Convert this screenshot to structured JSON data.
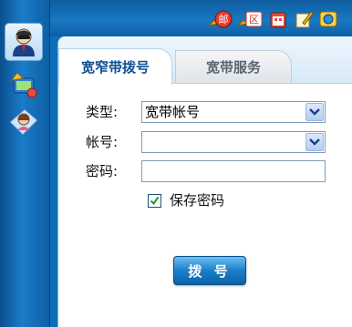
{
  "tabs": {
    "active": "宽窄带拨号",
    "inactive": "宽带服务"
  },
  "form": {
    "type_label": "类型:",
    "type_value": "宽带帐号",
    "account_label": "帐号:",
    "account_value": "",
    "password_label": "密码:",
    "password_value": "",
    "remember_label": "保存密码",
    "remember_checked": true,
    "dial_button": "拨 号"
  },
  "toolbar": {
    "icons": [
      "mail-icon",
      "region-icon",
      "calendar-icon",
      "note-icon",
      "browser-icon"
    ],
    "mail_badge": "邮",
    "region_badge": "区"
  },
  "sidebar": {
    "icons": [
      "user-avatar-icon",
      "network-icon",
      "contacts-book-icon"
    ]
  },
  "colors": {
    "brand_blue": "#0d6fb8",
    "tab_text_active": "#0c4f93",
    "button_blue": "#1b7fca"
  }
}
